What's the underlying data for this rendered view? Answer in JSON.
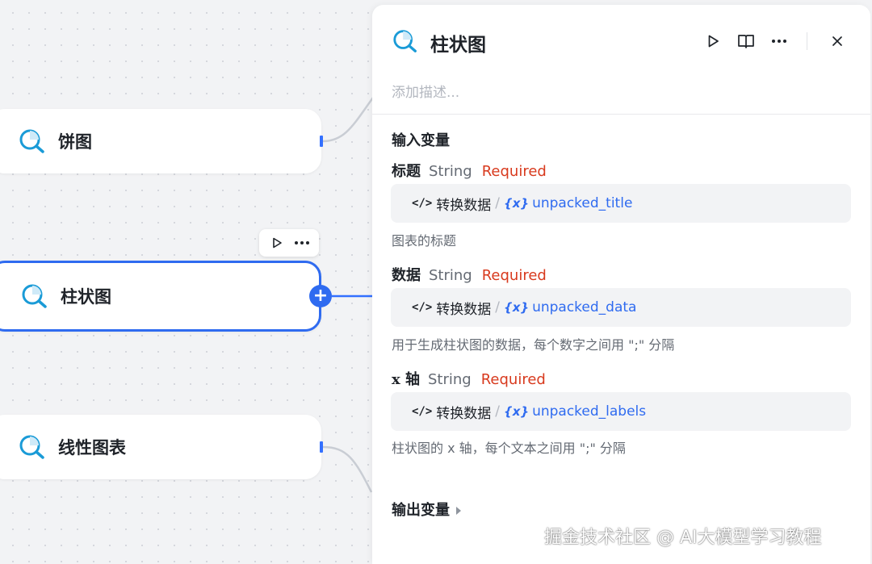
{
  "canvas": {
    "nodes": [
      {
        "label": "饼图",
        "icon": "chart-search-icon"
      },
      {
        "label": "柱状图",
        "icon": "chart-search-icon",
        "selected": true
      },
      {
        "label": "线性图表",
        "icon": "chart-search-icon"
      }
    ],
    "toolbar": {
      "run_icon": "play-icon",
      "more_icon": "more-dots-icon"
    },
    "add_port_symbol": "+"
  },
  "panel": {
    "title": "柱状图",
    "description_placeholder": "添加描述...",
    "header_icons": [
      "play-icon",
      "book-icon",
      "more-dots-icon",
      "close-icon"
    ],
    "input_section_title": "输入变量",
    "inputs": [
      {
        "name": "标题",
        "type": "String",
        "required": "Required",
        "ref_code": "</>",
        "ref_node": "转换数据",
        "ref_sep": "/",
        "ref_var_icon": "{x}",
        "ref_var": "unpacked_title",
        "hint": "图表的标题"
      },
      {
        "name": "数据",
        "type": "String",
        "required": "Required",
        "ref_code": "</>",
        "ref_node": "转换数据",
        "ref_sep": "/",
        "ref_var_icon": "{x}",
        "ref_var": "unpacked_data",
        "hint": "用于生成柱状图的数据，每个数字之间用 \";\" 分隔"
      },
      {
        "name": "x 轴",
        "type": "String",
        "required": "Required",
        "ref_code": "</>",
        "ref_node": "转换数据",
        "ref_sep": "/",
        "ref_var_icon": "{x}",
        "ref_var": "unpacked_labels",
        "hint": "柱状图的 x 轴，每个文本之间用 \";\" 分隔"
      }
    ],
    "output_section_title": "输出变量"
  },
  "colors": {
    "accent": "#2f6bf0",
    "required": "#d83a1e",
    "icon_teal": "#1a9bd7"
  },
  "watermark": "掘金技术社区 @ AI大模型学习教程"
}
